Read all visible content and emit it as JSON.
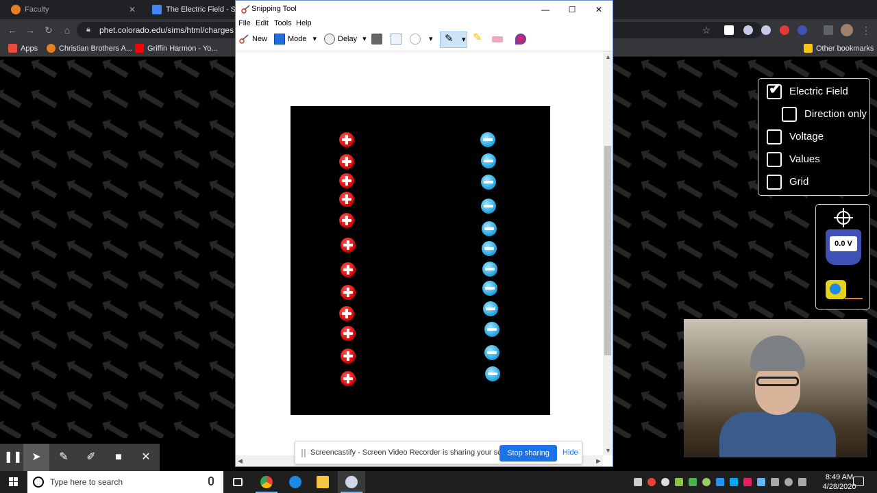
{
  "browser": {
    "tabs": [
      {
        "title": "Faculty",
        "close": "✕"
      },
      {
        "title": "The Electric Field - Simu"
      }
    ],
    "url": "phet.colorado.edu/sims/html/charges",
    "bookmarks": [
      "Apps",
      "Christian Brothers A...",
      "Griffin Harmon - Yo...",
      "Other bookmarks"
    ]
  },
  "snipping_tool": {
    "title": "Snipping Tool",
    "window_buttons": {
      "minimize": "—",
      "maximize": "☐",
      "close": "✕"
    },
    "menu": [
      "File",
      "Edit",
      "Tools",
      "Help"
    ],
    "toolbar": {
      "new": "New",
      "mode": "Mode",
      "delay": "Delay"
    },
    "scroll_up": "▲",
    "scroll_down": "▼",
    "scroll_left": "◀",
    "scroll_right": "▶",
    "positive_count": 12,
    "negative_count": 12
  },
  "phet": {
    "control_panel": [
      {
        "label": "Electric Field",
        "checked": true
      },
      {
        "label": "Direction only",
        "checked": false
      },
      {
        "label": "Voltage",
        "checked": false
      },
      {
        "label": "Values",
        "checked": false
      },
      {
        "label": "Grid",
        "checked": false
      }
    ],
    "voltmeter_reading": "0.0 V"
  },
  "share_bar": {
    "text": "Screencastify - Screen Video Recorder is sharing your screen.",
    "stop": "Stop sharing",
    "hide": "Hide"
  },
  "annotation_toolbar": {
    "pause": "❚❚",
    "cursor": "➤",
    "pen": "✎",
    "highlighter": "✐",
    "camera": "■",
    "close": "✕"
  },
  "taskbar": {
    "search_placeholder": "Type here to search",
    "time": "8:49 AM",
    "date": "4/28/2020"
  },
  "colors": {
    "positive": "#d40000",
    "negative": "#1aa3e0",
    "share_button": "#1a73e8"
  }
}
